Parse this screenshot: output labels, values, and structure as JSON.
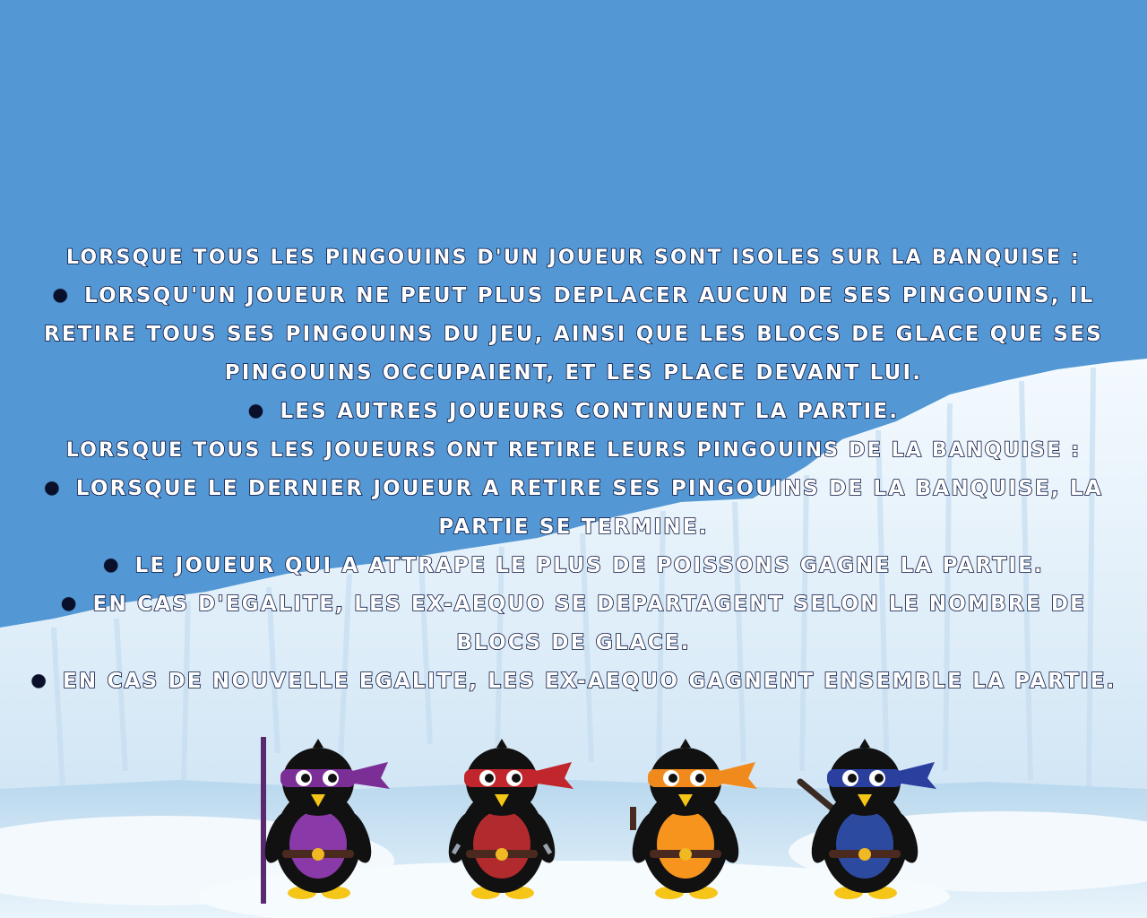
{
  "rules": [
    {
      "kind": "header",
      "text": "Lorsque tous les pingouins d'un joueur sont isoles sur la banquise :"
    },
    {
      "kind": "bullet",
      "text": "Lorsqu'un joueur ne peut plus deplacer aucun de ses pingouins, il retire tous ses pingouins du jeu, ainsi que les blocs de glace que ses pingouins occupaient, et les place devant lui."
    },
    {
      "kind": "bullet",
      "text": "Les autres joueurs continuent la partie."
    },
    {
      "kind": "header",
      "text": "Lorsque tous les joueurs ont retire leurs pingouins de la banquise :"
    },
    {
      "kind": "bullet",
      "text": "Lorsque le dernier joueur a retire ses pingouins de la banquise, la partie se termine."
    },
    {
      "kind": "bullet",
      "text": "Le joueur qui a attrape le plus de poissons gagne la partie."
    },
    {
      "kind": "bullet",
      "text": "En cas d'egalite, les ex-aequo se departagent selon le nombre de blocs de glace."
    },
    {
      "kind": "bullet",
      "text": "En cas de nouvelle egalite, les ex-aequo gagnent ensemble la partie."
    }
  ],
  "colors": {
    "sky": "#5398d4",
    "ice_light": "#eef6fc",
    "ice_shadow": "#bcd7ee",
    "ink": "#0b1540"
  },
  "penguins": [
    {
      "name": "purple-ninja-penguin",
      "mask": "#7b2f96",
      "belly": "#8a3aa8",
      "weapon": "bo-staff"
    },
    {
      "name": "red-ninja-penguin",
      "mask": "#c0262c",
      "belly": "#b12a2e",
      "weapon": "sai"
    },
    {
      "name": "orange-ninja-penguin",
      "mask": "#f08a1d",
      "belly": "#f7941d",
      "weapon": "nunchaku"
    },
    {
      "name": "blue-ninja-penguin",
      "mask": "#2a3f9e",
      "belly": "#2c4aa0",
      "weapon": "katana"
    }
  ]
}
